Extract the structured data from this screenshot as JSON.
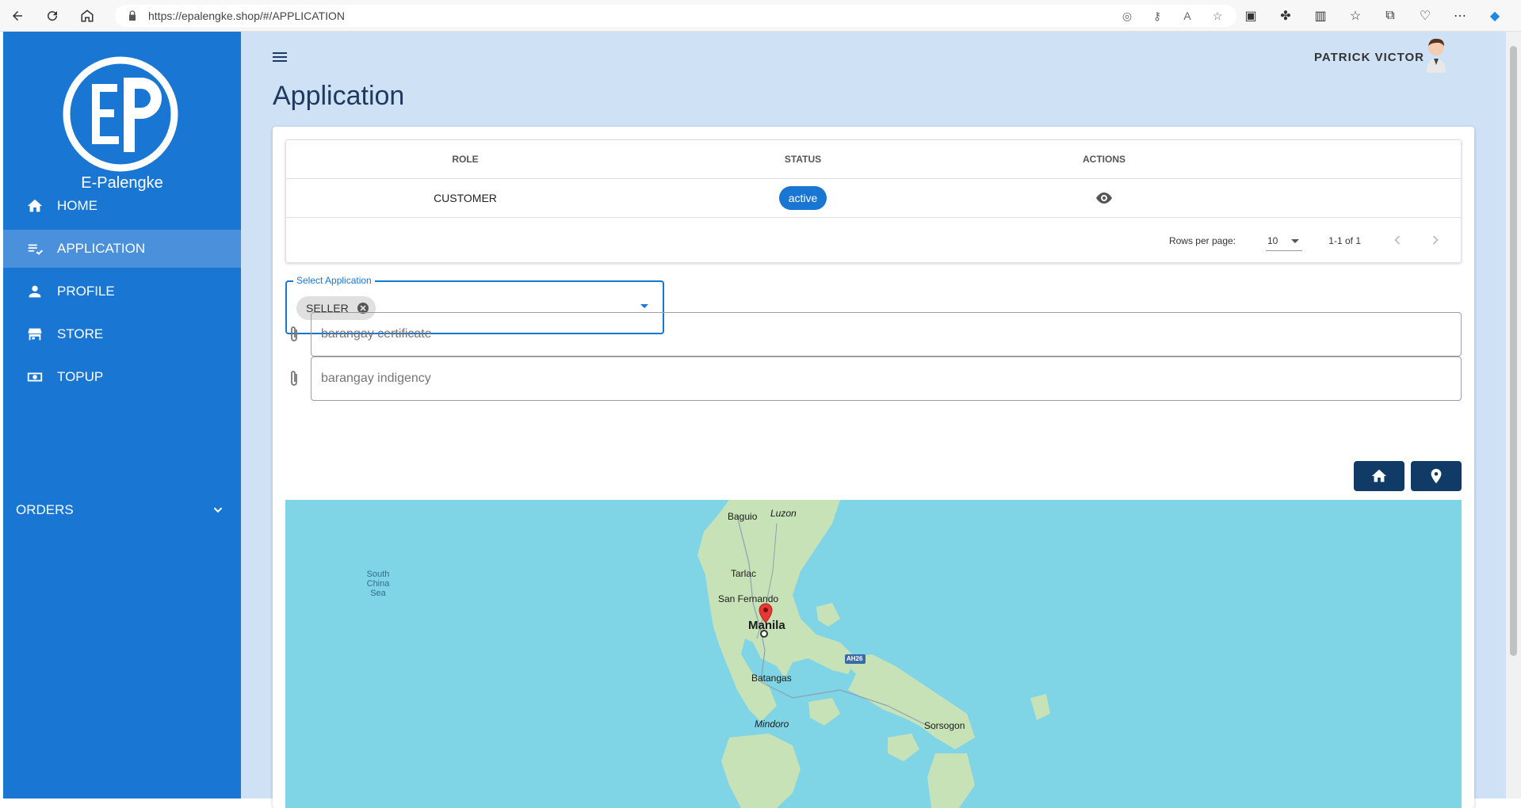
{
  "browser": {
    "url": "https://epalengke.shop/#/APPLICATION"
  },
  "app": {
    "brand": "E-Palengke",
    "logo_text": "EP",
    "user_name": "PATRICK VICTOR",
    "page_title": "Application"
  },
  "sidebar": {
    "items": [
      {
        "label": "HOME",
        "icon": "home-icon"
      },
      {
        "label": "APPLICATION",
        "icon": "playlist-check-icon"
      },
      {
        "label": "PROFILE",
        "icon": "person-icon"
      },
      {
        "label": "STORE",
        "icon": "store-icon"
      },
      {
        "label": "TOPUP",
        "icon": "cash-icon"
      }
    ],
    "orders_label": "ORDERS"
  },
  "table": {
    "headers": {
      "role": "ROLE",
      "status": "STATUS",
      "actions": "ACTIONS"
    },
    "rows": [
      {
        "role": "CUSTOMER",
        "status": "active"
      }
    ],
    "rows_per_page_label": "Rows per page:",
    "rows_per_page_value": "10",
    "range_text": "1-1 of 1"
  },
  "application_select": {
    "label": "Select Application",
    "selected": "SELLER"
  },
  "files": {
    "barangay_certificate": "barangay certificate",
    "barangay_indigency": "barangay indigency"
  },
  "map": {
    "labels": {
      "baguio": "Baguio",
      "luzon": "Luzon",
      "tarlac": "Tarlac",
      "san_fernando": "San Fernando",
      "manila": "Manila",
      "batangas": "Batangas",
      "mindoro": "Mindoro",
      "sorsogon": "Sorsogon",
      "sea_line1": "South",
      "sea_line2": "China Sea",
      "highway": "AH26"
    }
  },
  "colors": {
    "sidebar": "#1976d2",
    "accent": "#1976d2",
    "background": "#cfe1f5",
    "map_button": "#0f3b66",
    "water": "#7fd4e6"
  }
}
